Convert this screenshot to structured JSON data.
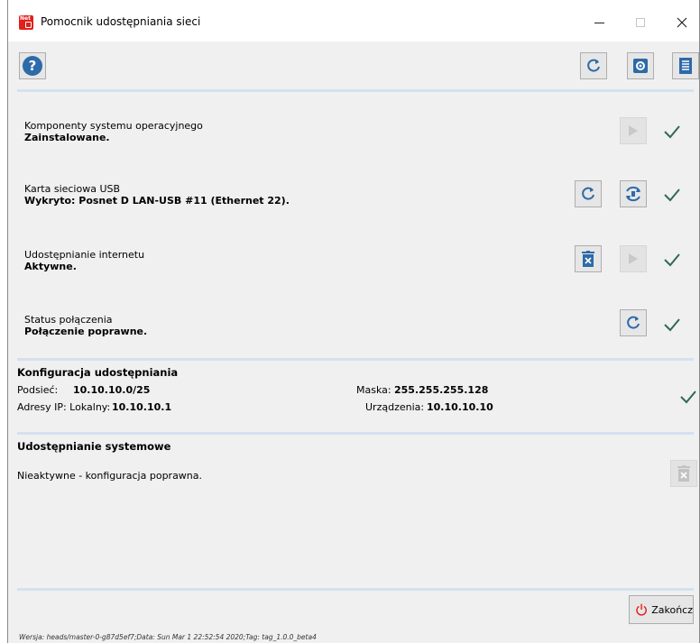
{
  "window": {
    "title": "Pomocnik udostępniania sieci",
    "icon_text": "Net"
  },
  "titlebar_controls": [
    "minimize-icon",
    "maximize-icon",
    "close-icon"
  ],
  "toolbar": {
    "help_icon": "question-icon",
    "refresh_icon": "refresh-icon",
    "settings_icon": "gear-icon",
    "log_icon": "document-list-icon"
  },
  "sections": {
    "os_components": {
      "label": "Komponenty systemu operacyjnego",
      "value": "Zainstalowane."
    },
    "usb_card": {
      "label": "Karta sieciowa USB",
      "value": "Wykryto: Posnet D LAN-USB #11 (Ethernet 22)."
    },
    "internet_sharing": {
      "label": "Udostępnianie internetu",
      "value": "Aktywne."
    },
    "connection_status": {
      "label": "Status połączenia",
      "value": "Połączenie poprawne."
    }
  },
  "config": {
    "title": "Konfiguracja udostępniania",
    "subnet_label": "Podsieć:",
    "subnet_value": "10.10.10.0/25",
    "mask_label": "Maska:",
    "mask_value": "255.255.255.128",
    "ip_label": "Adresy IP: Lokalny:",
    "ip_value": "10.10.10.1",
    "devices_label": "Urządzenia:",
    "devices_value": "10.10.10.10"
  },
  "system_sharing": {
    "title": "Udostępnianie systemowe",
    "status": "Nieaktywne - konfiguracja poprawna."
  },
  "finish_button": "Zakończ",
  "footer_version": "Wersja: heads/master-0-g87d5ef7;Data: Sun Mar 1 22:52:54 2020;Tag: tag_1.0.0_beta4",
  "colors": {
    "accent": "#2d6aa9",
    "check": "#2e6b4f",
    "separator": "#d5e1ef",
    "power": "#e0201b"
  }
}
